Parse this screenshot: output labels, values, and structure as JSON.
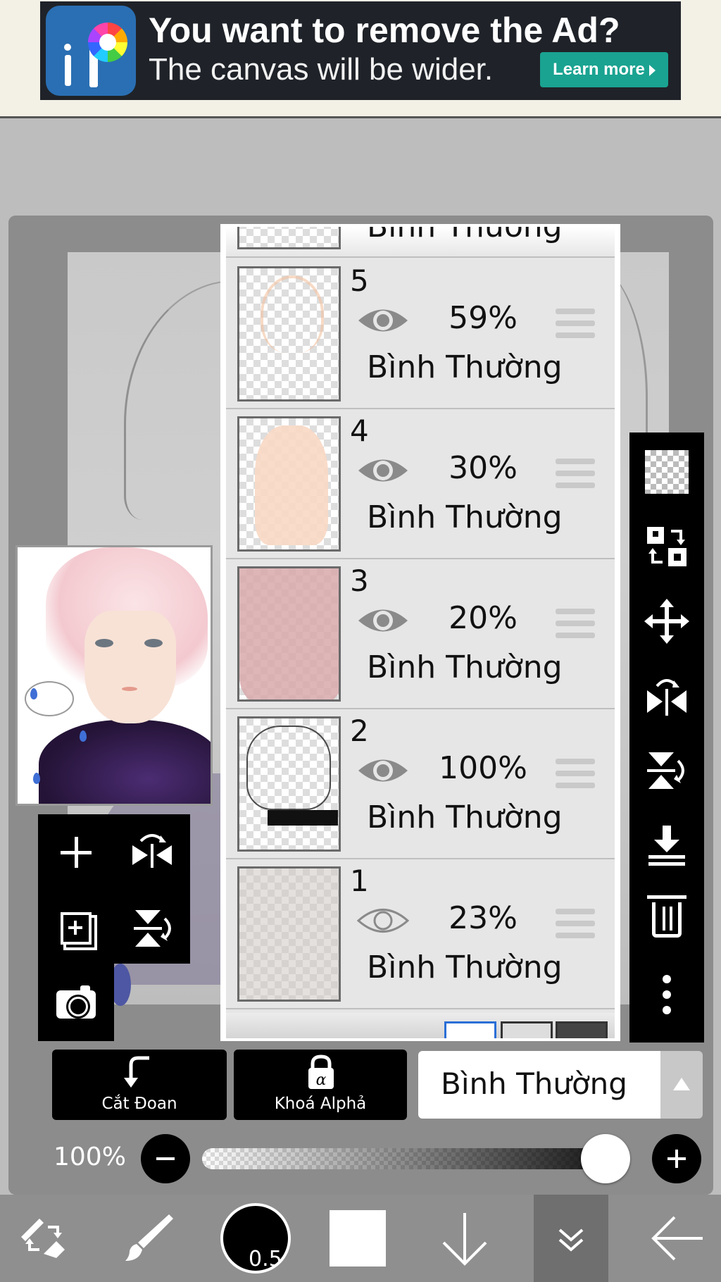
{
  "ad": {
    "title": "You want to remove the Ad?",
    "subtitle": "The canvas will be wider.",
    "button": "Learn more",
    "accent": "#1aa391"
  },
  "layers": {
    "top_partial_blend": "Bình Thường",
    "items": [
      {
        "number": "5",
        "opacity": "59%",
        "blend": "Bình Thường",
        "visible": true
      },
      {
        "number": "4",
        "opacity": "30%",
        "blend": "Bình Thường",
        "visible": true
      },
      {
        "number": "3",
        "opacity": "20%",
        "blend": "Bình Thường",
        "visible": true
      },
      {
        "number": "2",
        "opacity": "100%",
        "blend": "Bình Thường",
        "visible": true
      },
      {
        "number": "1",
        "opacity": "23%",
        "blend": "Bình Thường",
        "visible": false
      }
    ]
  },
  "controls": {
    "clipping_label": "Cắt Đoan",
    "alpha_lock_label": "Khoá Alphả",
    "blend_mode": "Bình Thường",
    "opacity_label": "100%",
    "opacity_value": 1.0
  },
  "toolbar": {
    "brush_size": "0.5",
    "color": "#ffffff"
  },
  "icons": {
    "left_tools": [
      "plus-icon",
      "flip-horizontal-icon",
      "add-layer-icon",
      "flip-vertical-icon",
      "camera-icon"
    ],
    "right_tools": [
      "transparent-icon",
      "swap-layer-icon",
      "move-icon",
      "flip-horizontal-icon",
      "flip-vertical-icon",
      "merge-down-icon",
      "trash-icon",
      "more-icon"
    ],
    "bottom": [
      "tool-switch-icon",
      "brush-icon",
      "brush-size-icon",
      "color-icon",
      "arrow-down-icon",
      "layers-collapse-icon",
      "back-arrow-icon"
    ]
  }
}
